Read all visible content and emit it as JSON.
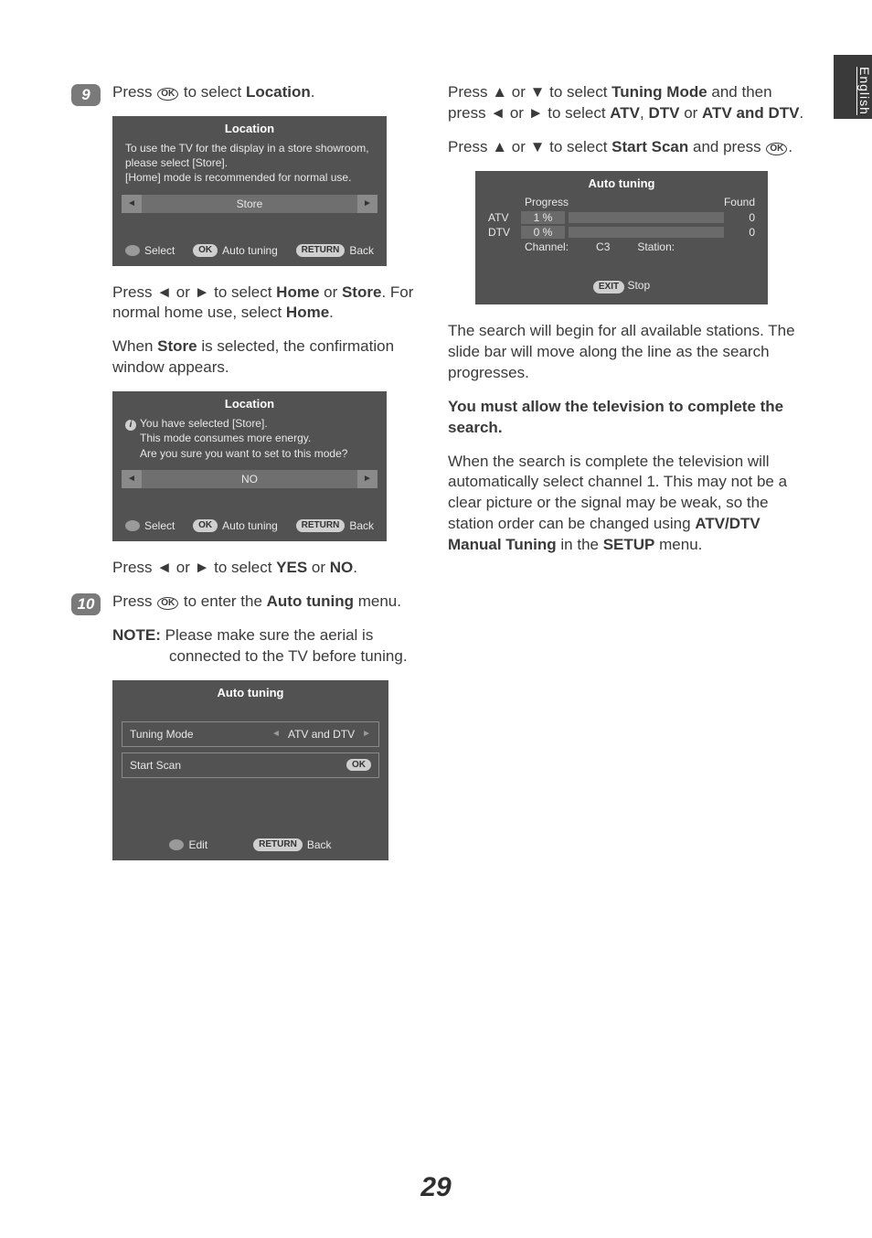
{
  "langTab": "English",
  "pageNumber": "29",
  "left": {
    "step9": {
      "badge": "9",
      "line1a": "Press ",
      "okGlyph": "OK",
      "line1b": " to select ",
      "loc": "Location",
      "dot": "."
    },
    "osdLoc": {
      "title": "Location",
      "desc1": "To use the TV for the display in a store showroom, please select [Store].",
      "desc2": "[Home] mode is recommended for normal use.",
      "value": "Store",
      "arrL": "◄",
      "arrR": "►",
      "footSelect": "Select",
      "footOk": "OK",
      "footAuto": "Auto tuning",
      "footReturn": "RETURN",
      "footBack": "Back"
    },
    "para1a": "Press ",
    "arrL": "◄",
    "or": " or ",
    "arrR": "►",
    "para1b": " to select ",
    "home": "Home",
    "orWord": " or ",
    "store": "Store",
    "para1c": ". For normal home use, select ",
    "home2": "Home",
    "para1d": ".",
    "para2a": "When ",
    "para2b": " is selected, the confirmation window appears.",
    "osdConfirm": {
      "title": "Location",
      "iGlyph": "i",
      "desc1": "You have selected [Store].",
      "desc2": "This mode consumes more energy.",
      "desc3": "Are you sure you want to set to this mode?",
      "value": "NO",
      "footSelect": "Select",
      "footOk": "OK",
      "footAuto": "Auto tuning",
      "footReturn": "RETURN",
      "footBack": "Back"
    },
    "para3a": "Press ",
    "para3b": " to select ",
    "yes": "YES",
    "no": "NO",
    "step10": {
      "badge": "10",
      "line1a": "Press ",
      "line1b": " to enter the ",
      "auto": "Auto tuning",
      "line1c": " menu."
    },
    "note": {
      "label": "NOTE:",
      "text": " Please make sure the aerial is connected to the TV before tuning."
    },
    "osdSettings": {
      "title": "Auto tuning",
      "row1Label": "Tuning Mode",
      "row1Value": "ATV and DTV",
      "row2Label": "Start Scan",
      "row2Btn": "OK",
      "footEdit": "Edit",
      "footReturn": "RETURN",
      "footBack": "Back"
    }
  },
  "right": {
    "para1a": "Press ",
    "arrU": "▲",
    "or": " or ",
    "arrD": "▼",
    "para1b": " to select ",
    "tuningMode": "Tuning Mode",
    "para1c": " and then press ",
    "arrL": "◄",
    "arrR": "►",
    "para1d": " to select ",
    "atv": "ATV",
    "comma": ", ",
    "dtv": "DTV",
    "orWord": " or ",
    "both": "ATV and DTV",
    "dot": ".",
    "para2a": "Press ",
    "para2b": " to select ",
    "startScan": "Start Scan",
    "para2c": " and press ",
    "okGlyph": "OK",
    "osdProg": {
      "title": "Auto tuning",
      "progress": "Progress",
      "found": "Found",
      "atvLabel": "ATV",
      "atvPct": "1   %",
      "atvFound": "0",
      "dtvLabel": "DTV",
      "dtvPct": "0   %",
      "dtvFound": "0",
      "channel": "Channel:",
      "channelVal": "C3",
      "station": "Station:",
      "exit": "EXIT",
      "stop": "Stop"
    },
    "para3": "The search will begin for all available stations. The slide bar will move along the line as the search progresses.",
    "para4": "You must allow the television to complete the search.",
    "para5a": "When the search is complete the television will automatically select channel 1. This may not be a clear picture or the signal may be weak, so the station order can be changed using ",
    "manual": "ATV/DTV Manual Tuning",
    "inThe": " in the ",
    "setup": "SETUP",
    "menuWord": " menu."
  }
}
